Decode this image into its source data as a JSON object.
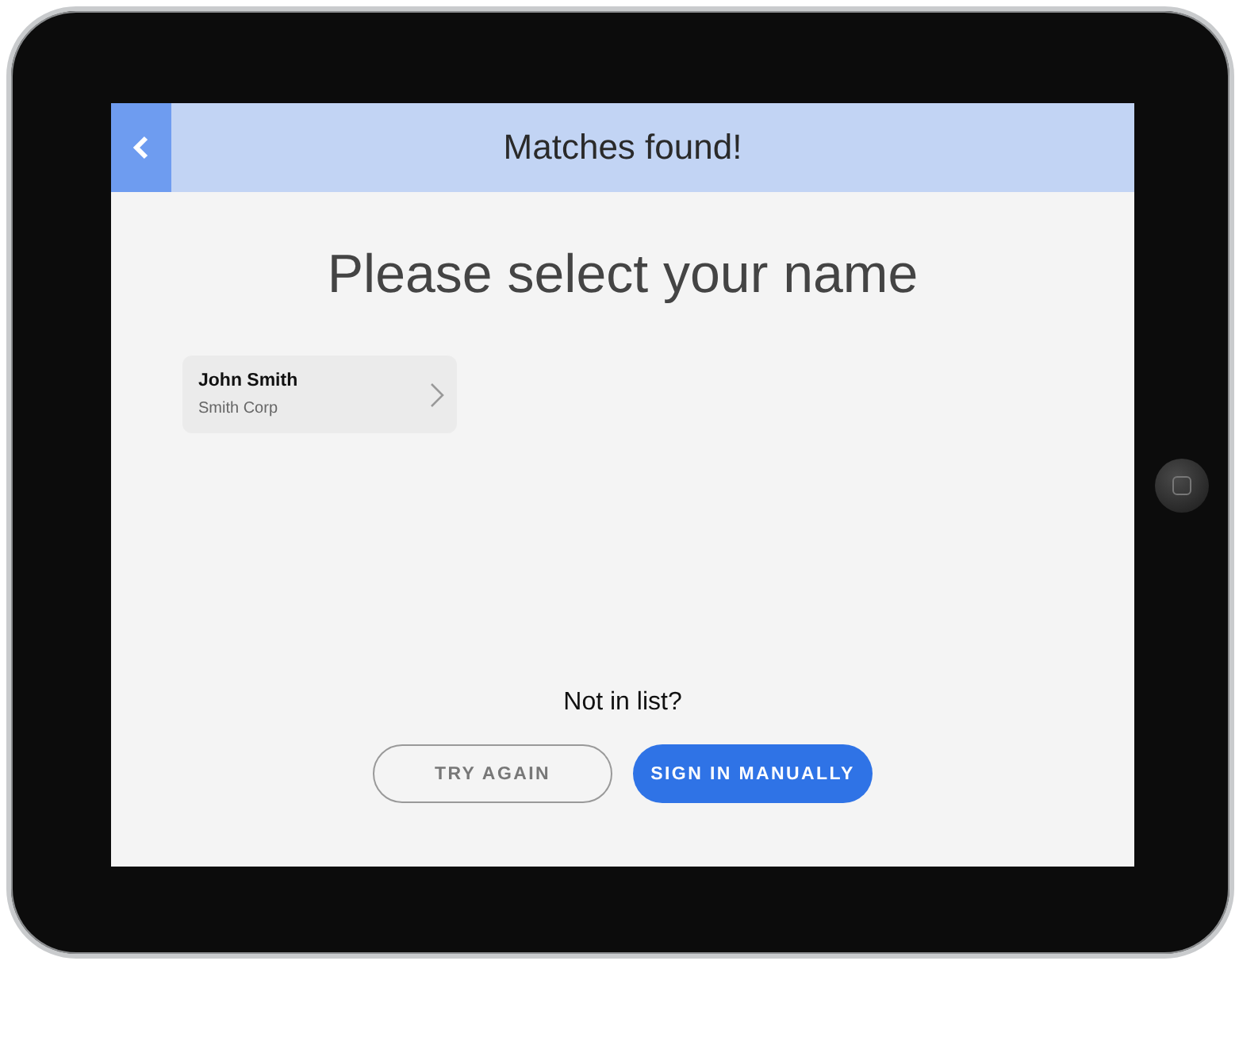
{
  "header": {
    "title": "Matches found!"
  },
  "heading": "Please select your name",
  "matches": [
    {
      "name": "John Smith",
      "company": "Smith Corp"
    }
  ],
  "footer": {
    "prompt": "Not in list?",
    "buttons": [
      {
        "label": "TRY AGAIN",
        "kind": "outline"
      },
      {
        "label": "SIGN IN MANUALLY",
        "kind": "primary"
      }
    ]
  }
}
